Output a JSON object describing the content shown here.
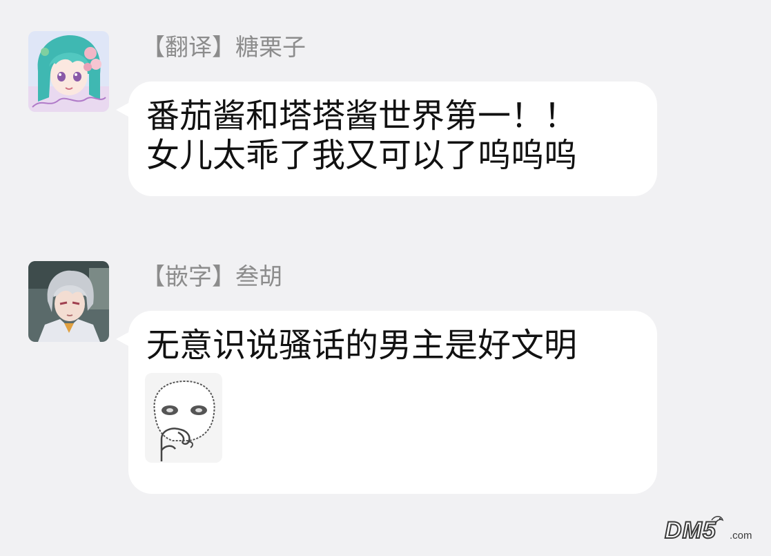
{
  "messages": [
    {
      "sender": "【翻译】糖栗子",
      "avatar": "anime-girl-teal-hair-avatar",
      "lines": [
        "番茄酱和塔塔酱世界第一！！",
        "女儿太乖了我又可以了呜呜呜"
      ]
    },
    {
      "sender": "【嵌字】叁胡",
      "avatar": "anime-boy-silver-hair-avatar",
      "lines": [
        "无意识说骚话的男主是好文明"
      ],
      "sticker": "thinking-face-sticker"
    }
  ],
  "watermark": {
    "main": "DM5",
    "suffix": ".com"
  },
  "colors": {
    "background": "#f1f1f3",
    "bubble": "#ffffff",
    "sender_text": "#8c8c8c",
    "message_text": "#111111"
  }
}
